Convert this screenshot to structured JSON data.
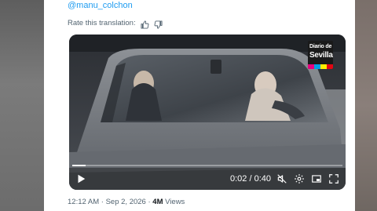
{
  "tweet": {
    "handle": "@manu_colchon",
    "rate_translation_label": "Rate this translation:",
    "thumbs_up_icon": "thumbs-up-icon",
    "thumbs_down_icon": "thumbs-down-icon"
  },
  "video": {
    "logo_line1": "Diario de",
    "logo_line2": "Sevilla",
    "logo_stripe_colors": [
      "#e6007e",
      "#009fe3",
      "#ffed00",
      "#e30613"
    ],
    "current_time": "0:02",
    "separator": "/",
    "duration": "0:40",
    "progress_fraction": 0.05,
    "icons": [
      "play-icon",
      "mute-icon",
      "settings-icon",
      "picture-in-picture-icon",
      "fullscreen-icon"
    ]
  },
  "meta": {
    "time": "12:12 AM",
    "dot": "·",
    "date": "Sep 2, 2026",
    "views_count": "4M",
    "views_label": "Views"
  },
  "colors": {
    "link": "#1d9bf0",
    "secondary_text": "#536471",
    "primary_text": "#0f1419"
  }
}
